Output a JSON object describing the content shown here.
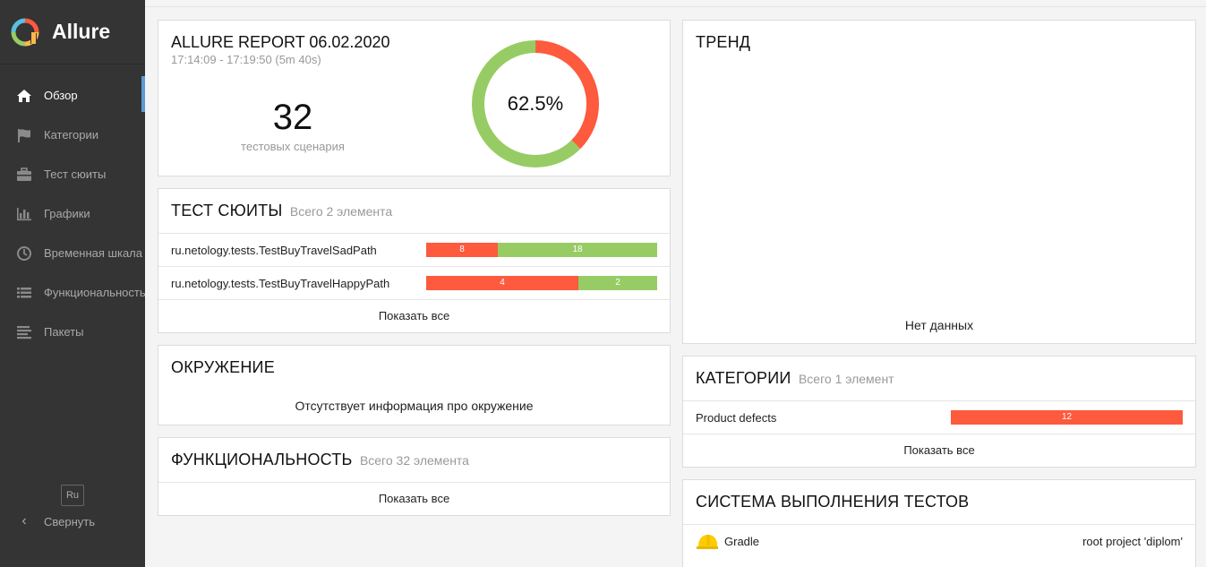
{
  "sidebar": {
    "brand": "Allure",
    "items": [
      {
        "label": "Обзор",
        "icon": "home-icon"
      },
      {
        "label": "Категории",
        "icon": "flag-icon"
      },
      {
        "label": "Тест сюиты",
        "icon": "briefcase-icon"
      },
      {
        "label": "Графики",
        "icon": "bar-chart-icon"
      },
      {
        "label": "Временная шкала",
        "icon": "clock-icon"
      },
      {
        "label": "Функциональность",
        "icon": "list-icon"
      },
      {
        "label": "Пакеты",
        "icon": "align-left-icon"
      }
    ],
    "lang": "Ru",
    "collapse": "Свернуть"
  },
  "summary": {
    "title": "ALLURE REPORT 06.02.2020",
    "time": "17:14:09 - 17:19:50 (5m 40s)",
    "count": "32",
    "count_label": "тестовых сценария",
    "percent": "62.5%",
    "passed_fraction": 0.625,
    "colors": {
      "failed": "#fd5a3e",
      "passed": "#97cc64"
    }
  },
  "suites": {
    "title": "ТЕСТ СЮИТЫ",
    "subtitle": "Всего 2 элемента",
    "rows": [
      {
        "name": "ru.netology.tests.TestBuyTravelSadPath",
        "failed": "8",
        "passed": "18"
      },
      {
        "name": "ru.netology.tests.TestBuyTravelHappyPath",
        "failed": "4",
        "passed": "2"
      }
    ],
    "show_all": "Показать все"
  },
  "environment": {
    "title": "ОКРУЖЕНИЕ",
    "empty": "Отсутствует информация про окружение"
  },
  "features": {
    "title": "ФУНКЦИОНАЛЬНОСТЬ",
    "subtitle": "Всего 32 элемента",
    "show_all": "Показать все"
  },
  "trend": {
    "title": "ТРЕНД",
    "empty": "Нет данных"
  },
  "categories": {
    "title": "КАТЕГОРИИ",
    "subtitle": "Всего 1 элемент",
    "rows": [
      {
        "name": "Product defects",
        "count": "12"
      }
    ],
    "show_all": "Показать все"
  },
  "executor": {
    "title": "СИСТЕМА ВЫПОЛНЕНИЯ ТЕСТОВ",
    "name": "Gradle",
    "icon": "gradle-helmet-icon",
    "value": "root project 'diplom'"
  }
}
